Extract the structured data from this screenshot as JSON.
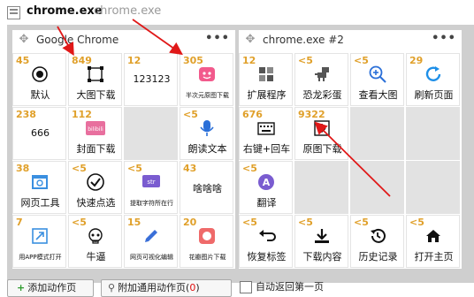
{
  "tabs": {
    "active": "chrome.exe",
    "inactive": "chrome.exe"
  },
  "panels": [
    {
      "title": "Google Chrome",
      "more": "•••",
      "cells": [
        {
          "count": "45",
          "label": "默认",
          "icon": "target-icon"
        },
        {
          "count": "849",
          "label": "大图下载",
          "icon": "crop-icon"
        },
        {
          "count": "12",
          "label": "123123",
          "icon": "none"
        },
        {
          "count": "305",
          "label": "半次元原图下载",
          "icon": "pink-app-icon",
          "small": true
        },
        {
          "count": "238",
          "label": "666",
          "icon": "none"
        },
        {
          "count": "112",
          "label": "封面下载",
          "icon": "bilibili-icon"
        },
        {
          "count": "",
          "label": "",
          "empty": true
        },
        {
          "count": "<5",
          "label": "朗读文本",
          "icon": "microphone-icon"
        },
        {
          "count": "38",
          "label": "网页工具",
          "icon": "web-tool-icon"
        },
        {
          "count": "<5",
          "label": "快速点选",
          "icon": "check-circle-icon"
        },
        {
          "count": "<5",
          "label": "提取字符所在行",
          "icon": "str-icon",
          "small": true
        },
        {
          "count": "43",
          "label": "啥啥啥",
          "icon": "none"
        },
        {
          "count": "7",
          "label": "用APP模式打开",
          "icon": "app-open-icon",
          "small": true
        },
        {
          "count": "<5",
          "label": "牛逼",
          "icon": "skull-icon"
        },
        {
          "count": "15",
          "label": "网页可视化编辑",
          "icon": "pencil-icon",
          "small": true
        },
        {
          "count": "20",
          "label": "花瓣图片下载",
          "icon": "petal-icon",
          "small": true
        }
      ]
    },
    {
      "title": "chrome.exe #2",
      "more": "•••",
      "cells": [
        {
          "count": "12",
          "label": "扩展程序",
          "icon": "extension-icon"
        },
        {
          "count": "<5",
          "label": "恐龙彩蛋",
          "icon": "dino-icon"
        },
        {
          "count": "<5",
          "label": "查看大图",
          "icon": "zoom-in-icon"
        },
        {
          "count": "29",
          "label": "刷新页面",
          "icon": "refresh-icon"
        },
        {
          "count": "676",
          "label": "右键+回车",
          "icon": "keyboard-icon"
        },
        {
          "count": "9322",
          "label": "原图下载",
          "icon": "download-box-icon"
        },
        {
          "count": "",
          "label": "",
          "empty": true
        },
        {
          "count": "",
          "label": "",
          "empty": true
        },
        {
          "count": "<5",
          "label": "翻译",
          "icon": "translate-icon"
        },
        {
          "count": "",
          "label": "",
          "empty": true
        },
        {
          "count": "",
          "label": "",
          "empty": true
        },
        {
          "count": "",
          "label": "",
          "empty": true
        },
        {
          "count": "<5",
          "label": "恢复标签",
          "icon": "undo-icon"
        },
        {
          "count": "<5",
          "label": "下载内容",
          "icon": "download-icon"
        },
        {
          "count": "<5",
          "label": "历史记录",
          "icon": "history-icon"
        },
        {
          "count": "<5",
          "label": "打开主页",
          "icon": "home-icon"
        }
      ]
    }
  ],
  "bottom": {
    "add_action": "添加动作页",
    "add_common": "附加通用动作页(",
    "add_common_count": "0",
    "add_common_close": ")",
    "auto_return": "自动返回第一页"
  },
  "colors": {
    "count": "#e0a02a",
    "empty_cell": "#e2e2e2",
    "board": "#cfcfcf",
    "arrow": "#e01818"
  }
}
